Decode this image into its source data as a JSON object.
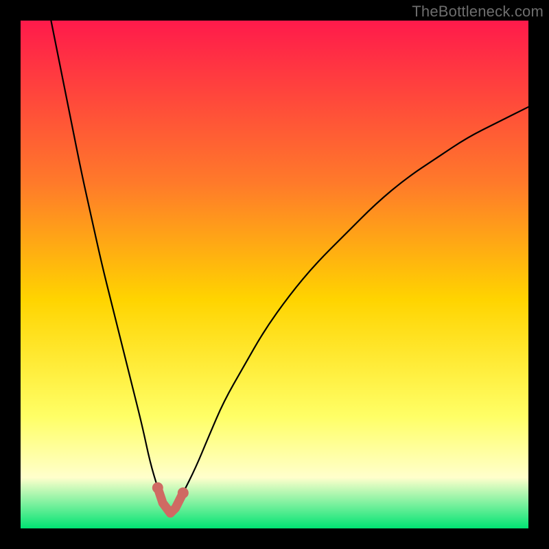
{
  "watermark": "TheBottleneck.com",
  "chart_data": {
    "type": "line",
    "title": "",
    "xlabel": "",
    "ylabel": "",
    "xlim": [
      0,
      100
    ],
    "ylim": [
      0,
      100
    ],
    "grid": false,
    "legend": false,
    "colors": {
      "gradient_top": "#ff1a4b",
      "gradient_mid1": "#ff7a2a",
      "gradient_mid2": "#ffd400",
      "gradient_mid3": "#ffff66",
      "gradient_mid4": "#ffffcc",
      "gradient_bottom": "#00e373",
      "curve": "#000000",
      "highlight": "#cf6a63"
    },
    "series": [
      {
        "name": "bottleneck-curve",
        "x": [
          6,
          8,
          10,
          12,
          14,
          16,
          18,
          20,
          22,
          24,
          25.5,
          27,
          28,
          29.5,
          30.5,
          32,
          34.5,
          37,
          40,
          44,
          48,
          53,
          58,
          64,
          70,
          76,
          82,
          88,
          94,
          100
        ],
        "y": [
          100,
          90,
          80,
          70,
          61,
          52,
          44,
          36,
          28,
          20,
          13,
          8,
          5,
          3,
          4,
          7,
          12,
          18,
          25,
          32,
          39,
          46,
          52,
          58,
          64,
          69,
          73,
          77,
          80,
          83
        ]
      }
    ],
    "highlight_segment": {
      "name": "curve-minimum",
      "x": [
        27,
        28,
        29.5,
        30.5,
        32
      ],
      "y": [
        8,
        5,
        3,
        4,
        7
      ]
    }
  }
}
